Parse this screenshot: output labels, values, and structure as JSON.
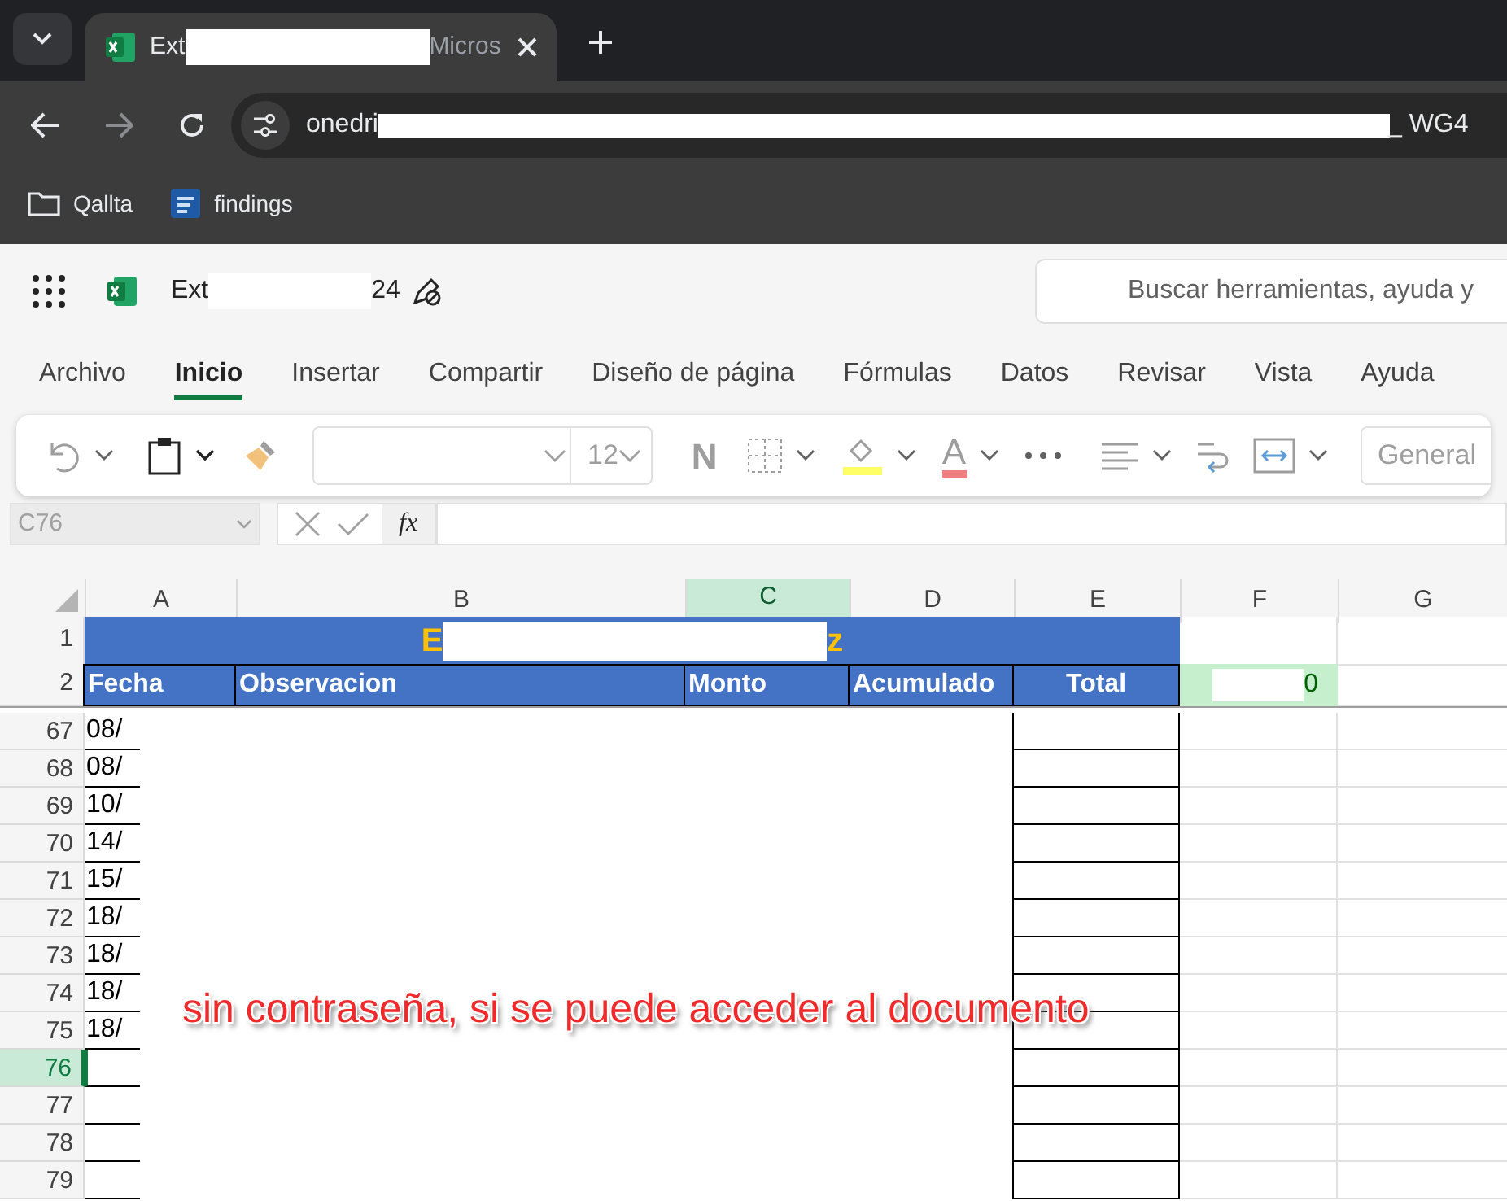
{
  "browser": {
    "tab": {
      "title_start": "Ext",
      "title_end": "Micros"
    },
    "address": {
      "start": "onedri",
      "end": "_ WG4"
    },
    "bookmarks": [
      {
        "kind": "folder",
        "label": "Qallta"
      },
      {
        "kind": "site",
        "label": "findings"
      }
    ]
  },
  "app": {
    "file_name": {
      "start": "Ext",
      "end": "24"
    },
    "search": {
      "placeholder": "Buscar herramientas, ayuda y"
    }
  },
  "menu_tabs": [
    {
      "label": "Archivo",
      "selected": false
    },
    {
      "label": "Inicio",
      "selected": true
    },
    {
      "label": "Insertar",
      "selected": false
    },
    {
      "label": "Compartir",
      "selected": false
    },
    {
      "label": "Diseño de página",
      "selected": false
    },
    {
      "label": "Fórmulas",
      "selected": false
    },
    {
      "label": "Datos",
      "selected": false
    },
    {
      "label": "Revisar",
      "selected": false
    },
    {
      "label": "Vista",
      "selected": false
    },
    {
      "label": "Ayuda",
      "selected": false
    }
  ],
  "ribbon": {
    "font_size": "12",
    "bold": "N",
    "font_color": "A",
    "number_format": "General"
  },
  "formula_bar": {
    "name_box": "C76",
    "function_label": "fx"
  },
  "sheet": {
    "columns": [
      {
        "label": "A",
        "selected": false
      },
      {
        "label": "B",
        "selected": false
      },
      {
        "label": "C",
        "selected": true
      },
      {
        "label": "D",
        "selected": false
      },
      {
        "label": "E",
        "selected": false
      },
      {
        "label": "F",
        "selected": false
      },
      {
        "label": "G",
        "selected": false
      }
    ],
    "title_row": {
      "number": "1",
      "start": "E",
      "end": "z"
    },
    "header_row": {
      "number": "2",
      "cells": [
        "Fecha",
        "Observacion",
        "Monto",
        "Acumulado",
        "Total"
      ],
      "f_value": "0"
    },
    "rows": [
      {
        "number": "67",
        "date": "08/",
        "selected": false
      },
      {
        "number": "68",
        "date": "08/",
        "selected": false
      },
      {
        "number": "69",
        "date": "10/",
        "selected": false
      },
      {
        "number": "70",
        "date": "14/",
        "selected": false
      },
      {
        "number": "71",
        "date": "15/",
        "selected": false
      },
      {
        "number": "72",
        "date": "18/",
        "selected": false
      },
      {
        "number": "73",
        "date": "18/",
        "selected": false
      },
      {
        "number": "74",
        "date": "18/",
        "selected": false
      },
      {
        "number": "75",
        "date": "18/",
        "selected": false
      },
      {
        "number": "76",
        "selected": true
      },
      {
        "number": "77",
        "selected": false
      },
      {
        "number": "78",
        "selected": false
      },
      {
        "number": "79",
        "selected": false
      }
    ]
  },
  "annotation": "sin contraseña, si se puede acceder al documento"
}
